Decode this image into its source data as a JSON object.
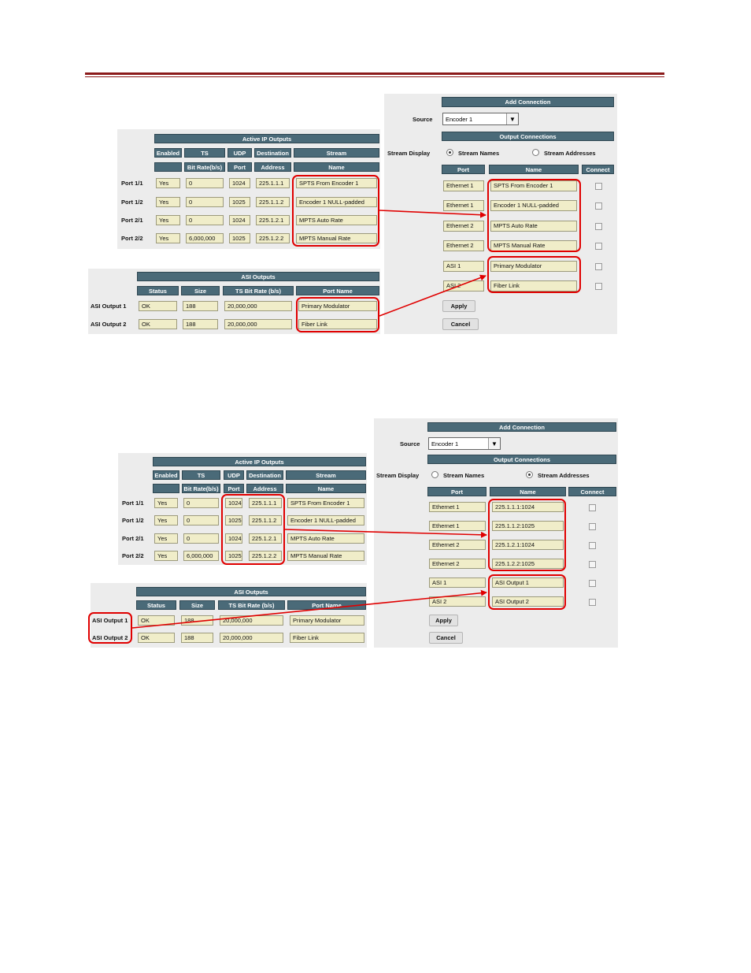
{
  "colors": {
    "header_rule": "#8b1a1a",
    "table_header": "#4a6a78",
    "field": "#f0edc9",
    "highlight": "#e00000"
  },
  "figures": [
    {
      "active_ip": {
        "title": "Active IP Outputs",
        "headers_top": [
          "Enabled",
          "TS",
          "UDP",
          "Destination",
          "Stream"
        ],
        "headers_bottom": [
          "",
          "Bit Rate(b/s)",
          "Port",
          "Address",
          "Name"
        ],
        "rows": [
          {
            "port": "Port 1/1",
            "enabled": "Yes",
            "bitrate": "0",
            "udp": "1024",
            "address": "225.1.1.1",
            "name": "SPTS From Encoder 1"
          },
          {
            "port": "Port 1/2",
            "enabled": "Yes",
            "bitrate": "0",
            "udp": "1025",
            "address": "225.1.1.2",
            "name": "Encoder 1 NULL-padded"
          },
          {
            "port": "Port 2/1",
            "enabled": "Yes",
            "bitrate": "0",
            "udp": "1024",
            "address": "225.1.2.1",
            "name": "MPTS Auto Rate"
          },
          {
            "port": "Port 2/2",
            "enabled": "Yes",
            "bitrate": "6,000,000",
            "udp": "1025",
            "address": "225.1.2.2",
            "name": "MPTS Manual Rate"
          }
        ]
      },
      "asi": {
        "title": "ASI Outputs",
        "headers": [
          "Status",
          "Size",
          "TS Bit Rate (b/s)",
          "Port Name"
        ],
        "rows": [
          {
            "label": "ASI Output 1",
            "status": "OK",
            "size": "188",
            "rate": "20,000,000",
            "name": "Primary Modulator"
          },
          {
            "label": "ASI Output 2",
            "status": "OK",
            "size": "188",
            "rate": "20,000,000",
            "name": "Fiber Link"
          }
        ]
      },
      "add": {
        "title": "Add Connection",
        "source_label": "Source",
        "source_value": "Encoder 1",
        "output_title": "Output Connections",
        "display_label": "Stream Display",
        "radio_names": "Stream Names",
        "radio_addresses": "Stream Addresses",
        "selected": "names",
        "headers": [
          "Port",
          "Name",
          "Connect"
        ],
        "rows": [
          {
            "port": "Ethernet 1",
            "name": "SPTS From Encoder 1"
          },
          {
            "port": "Ethernet 1",
            "name": "Encoder 1 NULL-padded"
          },
          {
            "port": "Ethernet 2",
            "name": "MPTS Auto Rate"
          },
          {
            "port": "Ethernet 2",
            "name": "MPTS Manual Rate"
          },
          {
            "port": "ASI 1",
            "name": "Primary Modulator"
          },
          {
            "port": "ASI 2",
            "name": "Fiber Link"
          }
        ],
        "apply": "Apply",
        "cancel": "Cancel"
      }
    },
    {
      "active_ip": {
        "title": "Active IP Outputs",
        "headers_top": [
          "Enabled",
          "TS",
          "UDP",
          "Destination",
          "Stream"
        ],
        "headers_bottom": [
          "",
          "Bit Rate(b/s)",
          "Port",
          "Address",
          "Name"
        ],
        "rows": [
          {
            "port": "Port 1/1",
            "enabled": "Yes",
            "bitrate": "0",
            "udp": "1024",
            "address": "225.1.1.1",
            "name": "SPTS From Encoder 1"
          },
          {
            "port": "Port 1/2",
            "enabled": "Yes",
            "bitrate": "0",
            "udp": "1025",
            "address": "225.1.1.2",
            "name": "Encoder 1 NULL-padded"
          },
          {
            "port": "Port 2/1",
            "enabled": "Yes",
            "bitrate": "0",
            "udp": "1024",
            "address": "225.1.2.1",
            "name": "MPTS Auto Rate"
          },
          {
            "port": "Port 2/2",
            "enabled": "Yes",
            "bitrate": "6,000,000",
            "udp": "1025",
            "address": "225.1.2.2",
            "name": "MPTS Manual Rate"
          }
        ]
      },
      "asi": {
        "title": "ASI Outputs",
        "headers": [
          "Status",
          "Size",
          "TS Bit Rate (b/s)",
          "Port Name"
        ],
        "rows": [
          {
            "label": "ASI Output 1",
            "status": "OK",
            "size": "188",
            "rate": "20,000,000",
            "name": "Primary Modulator"
          },
          {
            "label": "ASI Output 2",
            "status": "OK",
            "size": "188",
            "rate": "20,000,000",
            "name": "Fiber Link"
          }
        ]
      },
      "add": {
        "title": "Add Connection",
        "source_label": "Source",
        "source_value": "Encoder 1",
        "output_title": "Output Connections",
        "display_label": "Stream Display",
        "radio_names": "Stream Names",
        "radio_addresses": "Stream Addresses",
        "selected": "addresses",
        "headers": [
          "Port",
          "Name",
          "Connect"
        ],
        "rows": [
          {
            "port": "Ethernet 1",
            "name": "225.1.1.1:1024"
          },
          {
            "port": "Ethernet 1",
            "name": "225.1.1.2:1025"
          },
          {
            "port": "Ethernet 2",
            "name": "225.1.2.1:1024"
          },
          {
            "port": "Ethernet 2",
            "name": "225.1.2.2:1025"
          },
          {
            "port": "ASI 1",
            "name": "ASI Output 1"
          },
          {
            "port": "ASI 2",
            "name": "ASI Output 2"
          }
        ],
        "apply": "Apply",
        "cancel": "Cancel"
      }
    }
  ]
}
